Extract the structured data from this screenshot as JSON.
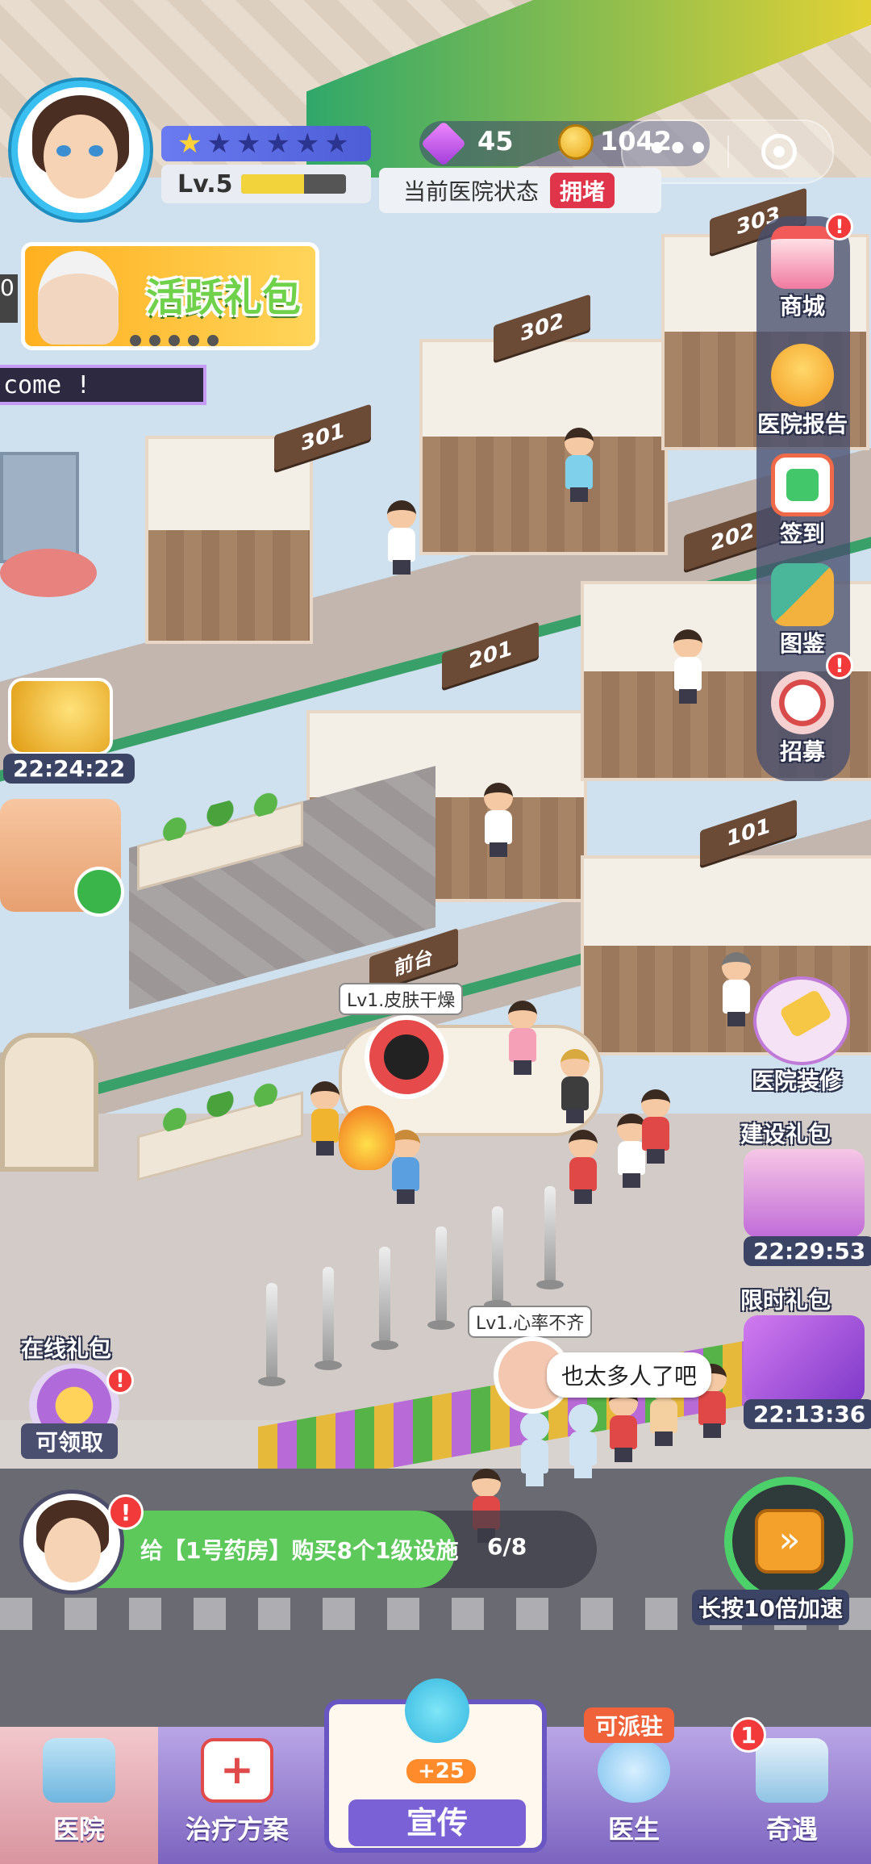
{
  "player": {
    "level": "Lv.5",
    "stars_filled": 1,
    "stars_total": 6,
    "exp_progress": 0.6
  },
  "currency": {
    "gems": "45",
    "coins": "1042"
  },
  "hospital_status": {
    "label": "当前医院状态",
    "value": "拥堵"
  },
  "banners": {
    "active_pack": "活跃礼包",
    "welcome": "come !"
  },
  "left_widgets": {
    "coin_timer": "22:24:22",
    "online_pack_title": "在线礼包",
    "online_pack_status": "可领取"
  },
  "side_menu": [
    {
      "label": "商城",
      "icon": "shop-icon",
      "alert": true
    },
    {
      "label": "医院报告",
      "icon": "report-icon",
      "alert": false
    },
    {
      "label": "签到",
      "icon": "checkin-icon",
      "alert": false
    },
    {
      "label": "图鉴",
      "icon": "collection-icon",
      "alert": false
    },
    {
      "label": "招募",
      "icon": "recruit-icon",
      "alert": true
    }
  ],
  "right_widgets": {
    "decorate": "医院装修",
    "build_pack": "建设礼包",
    "build_timer": "22:29:53",
    "limited_pack": "限时礼包",
    "limited_timer": "22:13:36",
    "speedup": "长按10倍加速"
  },
  "rooms": [
    "303",
    "302",
    "301",
    "202",
    "201",
    "101",
    "前台"
  ],
  "scene_labels": {
    "patient1": "Lv1.皮肤干燥",
    "patient2": "Lv1.心率不齐",
    "speech": "也太多人了吧"
  },
  "task": {
    "text": "给【1号药房】购买8个1级设施",
    "progress_text": "6/8",
    "progress": 0.75
  },
  "bottom_nav": {
    "hospital": "医院",
    "treatment": "治疗方案",
    "promote": "宣传",
    "promote_bonus": "+25",
    "doctor": "医生",
    "doctor_badge": "可派驻",
    "encounter": "奇遇",
    "encounter_badge": "1"
  },
  "colors": {
    "status_red": "#e0344a",
    "task_green": "#5cc95a",
    "nav_purple": "#8f78d0"
  }
}
